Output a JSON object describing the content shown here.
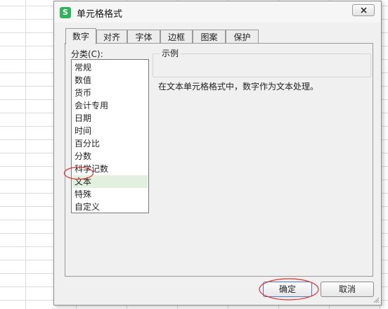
{
  "dialog": {
    "title": "单元格格式",
    "app_icon_letter": "S",
    "tabs": [
      {
        "label": "数字",
        "active": true
      },
      {
        "label": "对齐",
        "active": false
      },
      {
        "label": "字体",
        "active": false
      },
      {
        "label": "边框",
        "active": false
      },
      {
        "label": "图案",
        "active": false
      },
      {
        "label": "保护",
        "active": false
      }
    ],
    "category_label": "分类(C):",
    "categories": [
      "常规",
      "数值",
      "货币",
      "会计专用",
      "日期",
      "时间",
      "百分比",
      "分数",
      "科学记数",
      "文本",
      "特殊",
      "自定义"
    ],
    "selected_category": "文本",
    "sample_label": "示例",
    "description": "在文本单元格格式中，数字作为文本处理。",
    "ok_label": "确定",
    "cancel_label": "取消"
  },
  "colors": {
    "selection_bg": "#e1f0df",
    "annotation_red": "#e03030",
    "app_icon_green": "#2fb25a"
  }
}
